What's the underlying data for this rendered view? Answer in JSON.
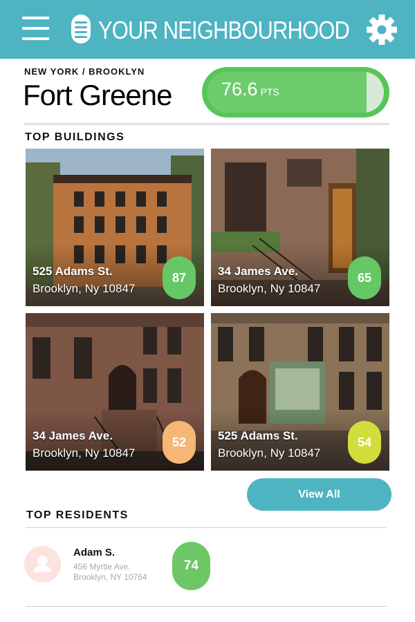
{
  "header": {
    "title": "YOUR NEIGHBOURHOOD",
    "menu_icon": "hamburger-menu-icon",
    "logo_icon": "building-logo-icon",
    "settings_icon": "gear-icon",
    "background_color": "#4fb4c2"
  },
  "location": {
    "breadcrumb": "NEW YORK / BROOKLYN",
    "name": "Fort Greene",
    "score": "76.6",
    "score_unit": "PTS",
    "score_fill_fraction": 0.9
  },
  "top_buildings": {
    "title": "TOP BUILDINGS",
    "items": [
      {
        "address": "525 Adams St.",
        "city": "Brooklyn, Ny 10847",
        "score": "87",
        "badge_color": "#65c766"
      },
      {
        "address": "34 James Ave.",
        "city": "Brooklyn, Ny 10847",
        "score": "65",
        "badge_color": "#65c766"
      },
      {
        "address": "34 James Ave.",
        "city": "Brooklyn, Ny 10847",
        "score": "52",
        "badge_color": "#f6b776"
      },
      {
        "address": "525 Adams St.",
        "city": "Brooklyn, Ny 10847",
        "score": "54",
        "badge_color": "#d0dd3a"
      }
    ],
    "view_all_label": "View All"
  },
  "top_residents": {
    "title": "TOP RESIDENTS",
    "items": [
      {
        "name": "Adam S.",
        "street": "456 Myrtle Ave.",
        "city": "Brooklyn, NY 10764",
        "score": "74",
        "avatar_icon": "user-avatar-icon"
      }
    ]
  },
  "colors": {
    "accent": "#4fb4c2",
    "score_green": "#57c559"
  }
}
